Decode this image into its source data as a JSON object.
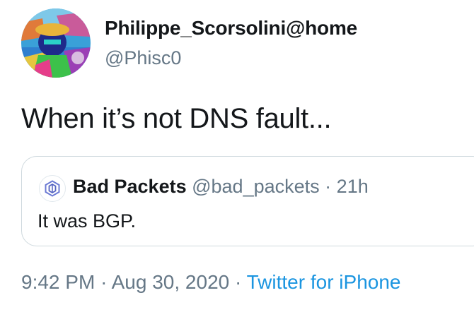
{
  "author": {
    "display_name": "Philippe_Scorsolini@home",
    "handle": "@Phisc0",
    "avatar_icon": "profile-photo"
  },
  "tweet": {
    "text": "When it’s not DNS fault..."
  },
  "quoted_tweet": {
    "display_name": "Bad Packets",
    "handle": "@bad_packets",
    "separator": "·",
    "time_ago": "21h",
    "text": "It was BGP.",
    "avatar_icon": "bad-packets-logo"
  },
  "footer": {
    "time": "9:42 PM",
    "separator_1": "·",
    "date": "Aug 30, 2020",
    "separator_2": "·",
    "source": "Twitter for iPhone"
  },
  "colors": {
    "text_primary": "#14171a",
    "text_secondary": "#657786",
    "link": "#1b95e0",
    "border": "#cfd9de"
  }
}
